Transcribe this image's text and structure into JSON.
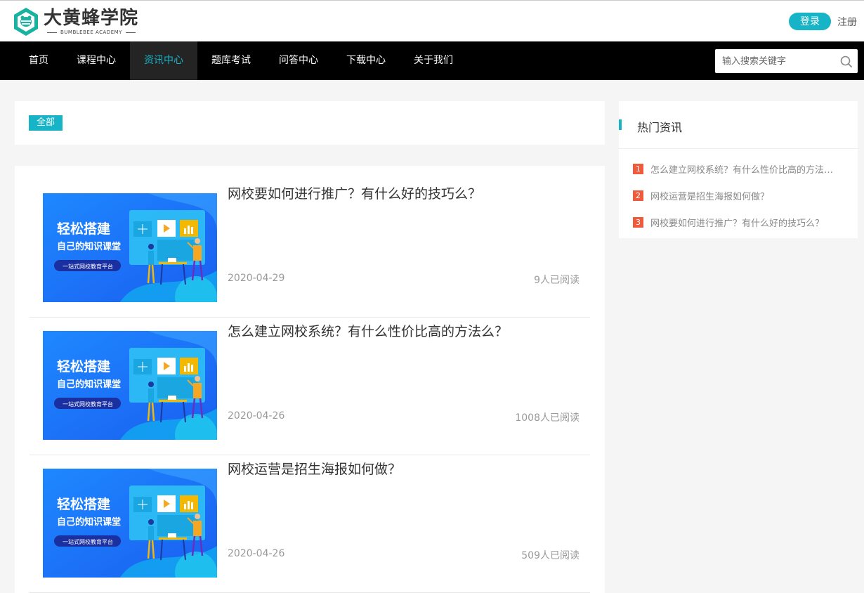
{
  "brand": {
    "name_cn": "大黄蜂学院",
    "name_en": "BUMBLEBEE ACADEMY"
  },
  "header": {
    "login_label": "登录",
    "register_label": "注册"
  },
  "nav": {
    "items": [
      {
        "label": "首页",
        "active": false
      },
      {
        "label": "课程中心",
        "active": false
      },
      {
        "label": "资讯中心",
        "active": true
      },
      {
        "label": "题库考试",
        "active": false
      },
      {
        "label": "问答中心",
        "active": false
      },
      {
        "label": "下载中心",
        "active": false
      },
      {
        "label": "关于我们",
        "active": false
      }
    ],
    "search_placeholder": "输入搜索关键字",
    "search_icon": "search-icon"
  },
  "filter": {
    "active_tag": "全部"
  },
  "thumbnail": {
    "headline": "轻松搭建",
    "subline": "自己的知识课堂",
    "badge": "一站式网校教育平台"
  },
  "articles": [
    {
      "title": "网校要如何进行推广？有什么好的技巧么？",
      "date": "2020-04-29",
      "reads": "9人已阅读"
    },
    {
      "title": "怎么建立网校系统？有什么性价比高的方法么？",
      "date": "2020-04-26",
      "reads": "1008人已阅读"
    },
    {
      "title": "网校运营是招生海报如何做？",
      "date": "2020-04-26",
      "reads": "509人已阅读"
    }
  ],
  "hot_news": {
    "title": "热门资讯",
    "items": [
      {
        "rank": "1",
        "text": "怎么建立网校系统？有什么性价比高的方法么？"
      },
      {
        "rank": "2",
        "text": "网校运营是招生海报如何做？"
      },
      {
        "rank": "3",
        "text": "网校要如何进行推广？有什么好的技巧么？"
      }
    ]
  },
  "colors": {
    "accent": "#17b3c6",
    "nav_bg": "#000000",
    "rank_badge": "#f05a3c"
  }
}
